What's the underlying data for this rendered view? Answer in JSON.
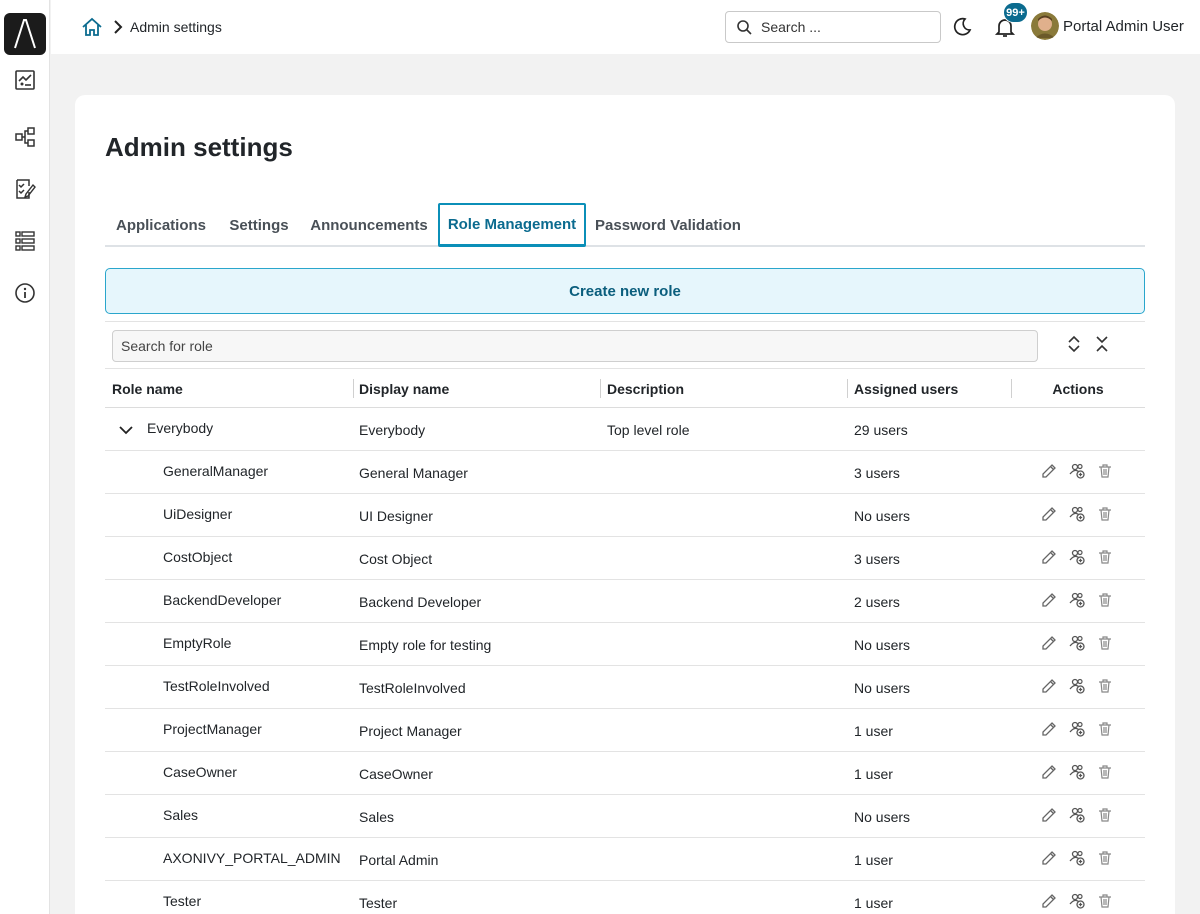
{
  "sidebar": {
    "logo_icon": "axon-logo",
    "items": [
      {
        "icon": "dashboard-chart-icon"
      },
      {
        "icon": "process-tree-icon"
      },
      {
        "icon": "task-list-check-icon"
      },
      {
        "icon": "case-list-icon"
      },
      {
        "icon": "info-icon"
      }
    ]
  },
  "header": {
    "breadcrumb_label": "Admin settings",
    "search_placeholder": "Search ...",
    "notification_count": "99+",
    "user_name": "Portal Admin User"
  },
  "page": {
    "title": "Admin settings"
  },
  "tabs": [
    {
      "label": "Applications",
      "active": false
    },
    {
      "label": "Settings",
      "active": false
    },
    {
      "label": "Announcements",
      "active": false
    },
    {
      "label": "Role Management",
      "active": true
    },
    {
      "label": "Password Validation",
      "active": false
    }
  ],
  "create_role_label": "Create new role",
  "role_search_placeholder": "Search for role",
  "table": {
    "columns": {
      "role_name": "Role name",
      "display_name": "Display name",
      "description": "Description",
      "assigned_users": "Assigned users",
      "actions": "Actions"
    },
    "root": {
      "role_name": "Everybody",
      "display_name": "Everybody",
      "description": "Top level role",
      "assigned_users": "29 users"
    },
    "rows": [
      {
        "role_name": "GeneralManager",
        "display_name": "General Manager",
        "description": "",
        "assigned_users": "3 users"
      },
      {
        "role_name": "UiDesigner",
        "display_name": "UI Designer",
        "description": "",
        "assigned_users": "No users"
      },
      {
        "role_name": "CostObject",
        "display_name": "Cost Object",
        "description": "",
        "assigned_users": "3 users"
      },
      {
        "role_name": "BackendDeveloper",
        "display_name": "Backend Developer",
        "description": "",
        "assigned_users": "2 users"
      },
      {
        "role_name": "EmptyRole",
        "display_name": "Empty role for testing",
        "description": "",
        "assigned_users": "No users"
      },
      {
        "role_name": "TestRoleInvolved",
        "display_name": "TestRoleInvolved",
        "description": "",
        "assigned_users": "No users"
      },
      {
        "role_name": "ProjectManager",
        "display_name": "Project Manager",
        "description": "",
        "assigned_users": "1 user"
      },
      {
        "role_name": "CaseOwner",
        "display_name": "CaseOwner",
        "description": "",
        "assigned_users": "1 user"
      },
      {
        "role_name": "Sales",
        "display_name": "Sales",
        "description": "",
        "assigned_users": "No users"
      },
      {
        "role_name": "AXONIVY_PORTAL_ADMIN",
        "display_name": "Portal Admin",
        "description": "",
        "assigned_users": "1 user"
      },
      {
        "role_name": "Tester",
        "display_name": "Tester",
        "description": "",
        "assigned_users": "1 user"
      }
    ]
  },
  "colors": {
    "accent": "#0b6b8f",
    "create_button_bg": "#e6f6fc",
    "create_button_border": "#2aa6cc",
    "page_bg": "#f2f2f2"
  }
}
